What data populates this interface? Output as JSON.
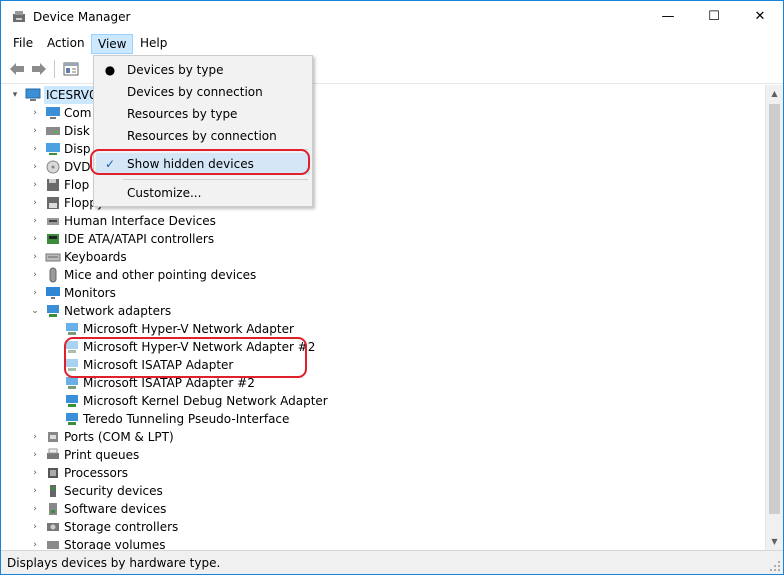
{
  "window": {
    "title": "Device Manager",
    "controls": {
      "minimize": "—",
      "maximize": "☐",
      "close": "✕"
    }
  },
  "menubar": {
    "items": [
      {
        "label": "File"
      },
      {
        "label": "Action"
      },
      {
        "label": "View"
      },
      {
        "label": "Help"
      }
    ]
  },
  "view_menu": {
    "items": [
      {
        "label": "Devices by type",
        "mark": "●"
      },
      {
        "label": "Devices by connection",
        "mark": ""
      },
      {
        "label": "Resources by type",
        "mark": ""
      },
      {
        "label": "Resources by connection",
        "mark": ""
      },
      {
        "label": "Show hidden devices",
        "mark": "✓"
      },
      {
        "label": "Customize...",
        "mark": ""
      }
    ]
  },
  "tree": {
    "root": {
      "label": "ICESRV0",
      "expander": "▾"
    },
    "categories": [
      {
        "label": "Com",
        "expander": "›"
      },
      {
        "label": "Disk",
        "expander": "›"
      },
      {
        "label": "Disp",
        "expander": "›"
      },
      {
        "label": "DVD",
        "expander": "›"
      },
      {
        "label": "Flop",
        "expander": "›"
      },
      {
        "label": "Floppy drive controllers",
        "expander": "›"
      },
      {
        "label": "Human Interface Devices",
        "expander": "›"
      },
      {
        "label": "IDE ATA/ATAPI controllers",
        "expander": "›"
      },
      {
        "label": "Keyboards",
        "expander": "›"
      },
      {
        "label": "Mice and other pointing devices",
        "expander": "›"
      },
      {
        "label": "Monitors",
        "expander": "›"
      },
      {
        "label": "Network adapters",
        "expander": "⌄"
      }
    ],
    "network_adapters": [
      {
        "label": "Microsoft Hyper-V Network Adapter"
      },
      {
        "label": "Microsoft Hyper-V Network Adapter #2"
      },
      {
        "label": "Microsoft ISATAP Adapter"
      },
      {
        "label": "Microsoft ISATAP Adapter #2"
      },
      {
        "label": "Microsoft Kernel Debug Network Adapter"
      },
      {
        "label": "Teredo Tunneling Pseudo-Interface"
      }
    ],
    "categories_after": [
      {
        "label": "Ports (COM & LPT)",
        "expander": "›"
      },
      {
        "label": "Print queues",
        "expander": "›"
      },
      {
        "label": "Processors",
        "expander": "›"
      },
      {
        "label": "Security devices",
        "expander": "›"
      },
      {
        "label": "Software devices",
        "expander": "›"
      },
      {
        "label": "Storage controllers",
        "expander": "›"
      },
      {
        "label": "Storage volumes",
        "expander": "›"
      }
    ]
  },
  "scrollbar": {
    "up": "▲",
    "down": "▼"
  },
  "status": {
    "text": "Displays devices by hardware type."
  },
  "colors": {
    "accent": "#1883d7",
    "highlight": "#e0202a",
    "menu_active": "#cce8ff"
  }
}
